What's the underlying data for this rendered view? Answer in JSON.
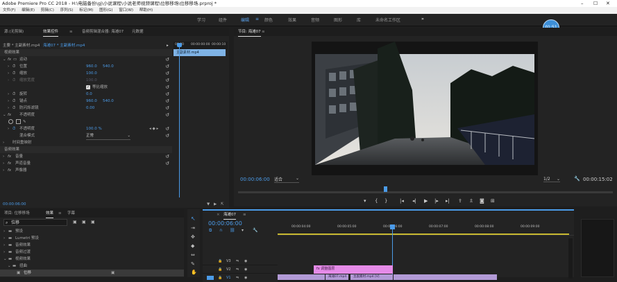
{
  "window": {
    "title": "Adobe Premiere Pro CC 2018 - H:\\电脑备份\\gj\\小说课程\\小说老师视频课程\\位移移场\\位移移场.prproj *"
  },
  "menu": [
    "文件(F)",
    "编辑(E)",
    "剪辑(C)",
    "序列(S)",
    "标记(M)",
    "图形(G)",
    "窗口(W)",
    "帮助(H)"
  ],
  "workspaces": [
    "学习",
    "组件",
    "编辑",
    "颜色",
    "效果",
    "音频",
    "图形",
    "库",
    "未命名工作区"
  ],
  "workspace_more": "»",
  "clock": "01:51",
  "effect_controls": {
    "tabs": [
      "源:(无剪辑)",
      "效果控件",
      "音频剪辑混合器: 海滩07",
      "元数据"
    ],
    "source_label": "主要 * 主副素材.mp4",
    "clip_label": "海滩07 * 主副素材.mp4",
    "ruler_start": "00:00",
    "ruler_mid": "00:00:00:00",
    "ruler_end": "00:00:10",
    "clip_bar": "主副素材.mp4",
    "section_video": "视频效果",
    "motion": "运动",
    "properties": [
      {
        "label": "位置",
        "values": [
          "960.0",
          "540.0"
        ]
      },
      {
        "label": "缩放",
        "values": [
          "100.0"
        ]
      },
      {
        "label": "缩放宽度",
        "values": [
          "100.0"
        ]
      },
      {
        "label": "等比缩放",
        "values": []
      },
      {
        "label": "旋转",
        "values": [
          "0.0"
        ]
      },
      {
        "label": "锚点",
        "values": [
          "960.0",
          "540.0"
        ]
      },
      {
        "label": "防闪烁滤镜",
        "values": [
          "0.00"
        ]
      }
    ],
    "opacity": "不透明度",
    "opacity_value": "100.0 %",
    "blend_label": "混合模式",
    "blend_value": "正常",
    "time_remap": "时间重映射",
    "section_audio": "音频效果",
    "audio_items": [
      "音量",
      "声道音量",
      "声像器"
    ],
    "timecode": "00:00:06:00"
  },
  "program": {
    "tab": "节目: 海滩07",
    "timecode": "00:00:06:00",
    "fit": "适合",
    "resolution": "1/2",
    "duration": "00:00:15:02"
  },
  "project": {
    "tabs": [
      "项目: 位移移场",
      "效果",
      "字幕"
    ],
    "search_placeholder": "位移",
    "tree": [
      "预设",
      "Lumetri 预设",
      "音频效果",
      "音频过渡",
      "视频效果",
      "扭曲",
      "位移"
    ]
  },
  "timeline": {
    "tab": "海滩07",
    "timecode": "00:00:06:00",
    "ruler": [
      "00:00:04:00",
      "00:00:05:00",
      "00:00:06:00",
      "00:00:07:00",
      "00:00:08:00",
      "00:00:09:00"
    ],
    "tracks": [
      "V3",
      "V2",
      "V1"
    ],
    "clip_v2": "fx 调整图层",
    "clip_v1a": "海滩07.mp4",
    "clip_v1b": "主副素材.mp4 [V]"
  },
  "colors": {
    "accent": "#4b9be8",
    "clip_pink": "#e58be8",
    "clip_purple": "#b29ad6"
  }
}
